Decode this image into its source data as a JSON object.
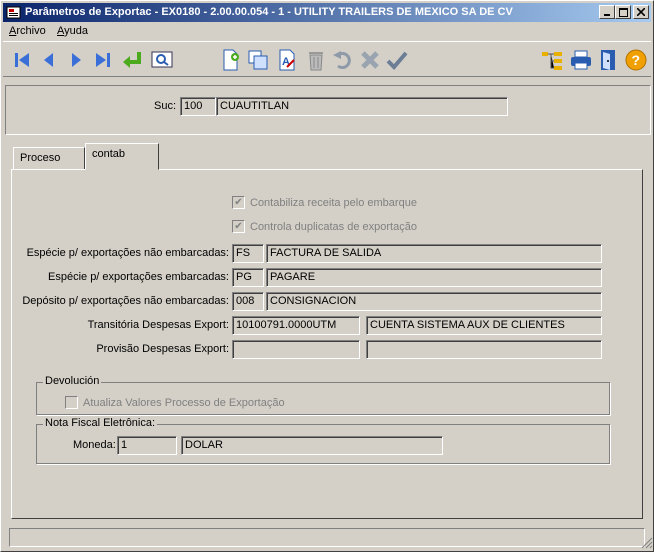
{
  "window": {
    "title": "Parâmetros de Exportac - EX0180 - 2.00.00.054 - 1 - UTILITY TRAILERS DE MEXICO SA DE CV"
  },
  "menu": {
    "items": [
      {
        "label": "Archivo",
        "mnemonic": "A"
      },
      {
        "label": "Ayuda",
        "mnemonic": "A"
      }
    ]
  },
  "toolbar": {
    "icons": [
      "first-icon",
      "prev-icon",
      "next-icon",
      "last-icon",
      "goto-icon",
      "search-icon",
      "new-icon",
      "copy-icon",
      "edit-icon",
      "delete-icon",
      "undo-icon",
      "cancel-icon",
      "confirm-icon",
      "tree-icon",
      "print-icon",
      "exit-icon",
      "help-icon"
    ],
    "help_glyph": "?"
  },
  "header": {
    "suc_label": "Suc:",
    "suc_code": "100",
    "suc_name": "CUAUTITLAN"
  },
  "tabs": [
    {
      "label": "Proceso"
    },
    {
      "label": "contab"
    }
  ],
  "contab": {
    "chk_receita": {
      "label": "Contabiliza receita pelo embarque",
      "checked": true
    },
    "chk_duplicatas": {
      "label": "Controla duplicatas de exportação",
      "checked": true
    },
    "rows": [
      {
        "label": "Espécie p/ exportações não embarcadas:",
        "code": "FS",
        "desc": "FACTURA DE SALIDA"
      },
      {
        "label": "Espécie p/ exportações embarcadas:",
        "code": "PG",
        "desc": "PAGARE"
      },
      {
        "label": "Depósito p/ exportações não embarcadas:",
        "code": "008",
        "desc": "CONSIGNACION"
      },
      {
        "label": "Transitória Despesas Export:",
        "code": "10100791.0000UTM",
        "desc": "CUENTA SISTEMA AUX DE CLIENTES"
      },
      {
        "label": "Provisão Despesas Export:",
        "code": "",
        "desc": ""
      }
    ],
    "devolucion": {
      "title": "Devolución",
      "chk_label": "Atualiza Valores Processo de Exportação"
    },
    "nfe": {
      "title": "Nota Fiscal Eletrônica:",
      "moneda_label": "Moneda:",
      "moneda_code": "1",
      "moneda_name": "DOLAR"
    }
  },
  "colors": {
    "title_start": "#0a246a",
    "title_end": "#a6caf0",
    "face": "#d4d0c8"
  }
}
